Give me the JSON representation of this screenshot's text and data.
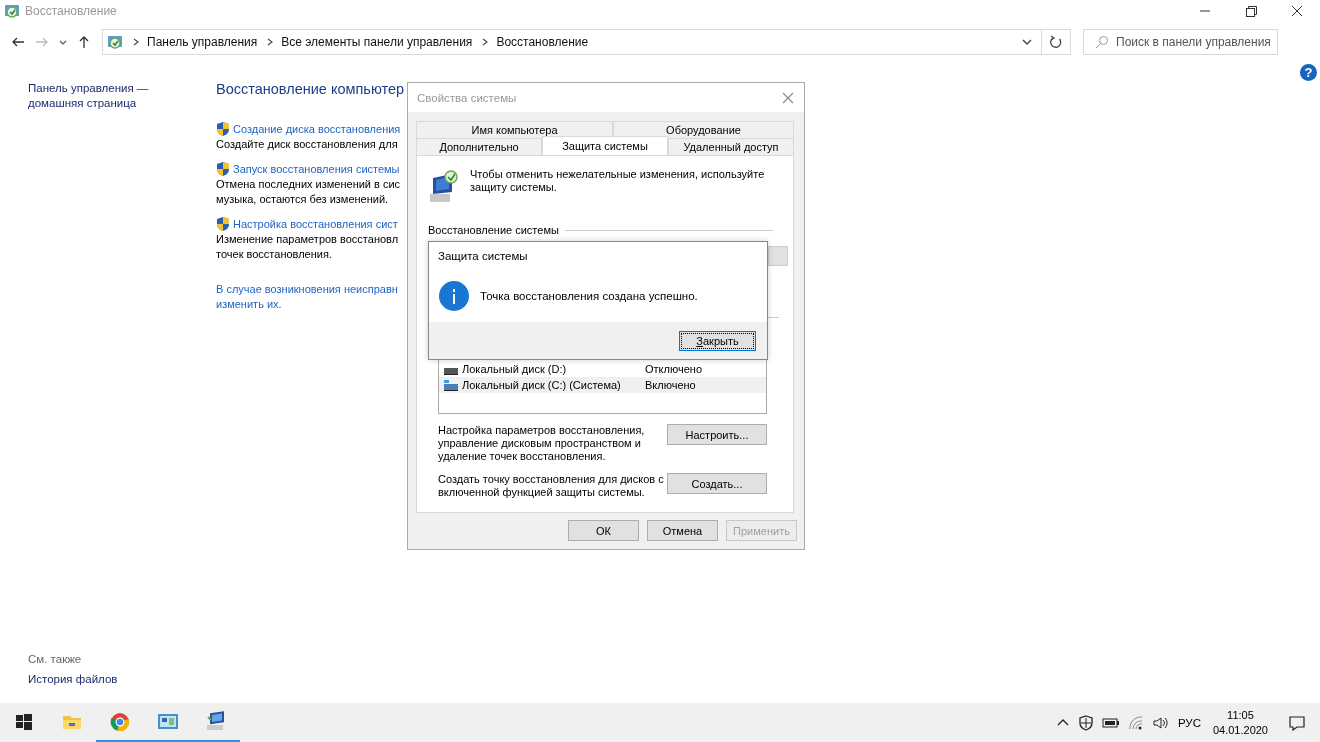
{
  "window": {
    "title": "Восстановление"
  },
  "address_bar": {
    "breadcrumbs": [
      "Панель управления",
      "Все элементы панели управления",
      "Восстановление"
    ],
    "search": {
      "placeholder": "Поиск в панели управления"
    }
  },
  "help": "?",
  "sidebar": {
    "home_link": "Панель управления — домашняя страница",
    "see_also": {
      "heading": "См. также",
      "links": [
        "История файлов"
      ]
    }
  },
  "main": {
    "title": "Восстановление компьютер",
    "tasks": [
      {
        "link": "Создание диска восстановления",
        "description_lines": [
          "Создайте диск восстановления для"
        ]
      },
      {
        "link": "Запуск восстановления системы",
        "description_lines": [
          "Отмена последних изменений в сис",
          "музыка, остаются без изменений."
        ]
      },
      {
        "link": "Настройка восстановления сист",
        "description_lines": [
          "Изменение параметров восстановл",
          "точек восстановления."
        ]
      }
    ],
    "footer_link_lines": [
      "В случае возникновения неисправн",
      "изменить их."
    ]
  },
  "system_properties": {
    "title": "Свойства системы",
    "tab_rows": [
      [
        {
          "label": "Имя компьютера",
          "selected": false
        },
        {
          "label": "Оборудование",
          "selected": false
        }
      ],
      [
        {
          "label": "Дополнительно",
          "selected": false
        },
        {
          "label": "Защита системы",
          "selected": true
        },
        {
          "label": "Удаленный доступ",
          "selected": false
        }
      ]
    ],
    "intro": "Чтобы отменить нежелательные изменения, используйте защиту системы.",
    "restore_group": "Восстановление системы",
    "drives": [
      {
        "name": "Локальный диск (D:)",
        "status": "Отключено",
        "system": false,
        "selected": false
      },
      {
        "name": "Локальный диск (C:) (Система)",
        "status": "Включено",
        "system": true,
        "selected": true
      }
    ],
    "configure_text": "Настройка параметров восстановления, управление дисковым пространством и удаление точек восстановления.",
    "configure_button": "Настроить...",
    "create_text": "Создать точку восстановления для дисков с включенной функцией защиты системы.",
    "create_button": "Создать...",
    "buttons": [
      {
        "label": "ОК",
        "disabled": false
      },
      {
        "label": "Отмена",
        "disabled": false
      },
      {
        "label": "Применить",
        "disabled": true
      }
    ]
  },
  "message_box": {
    "title": "Защита системы",
    "message": "Точка восстановления создана успешно.",
    "button": "Закрыть"
  },
  "taskbar": {
    "apps": [
      {
        "kind": "start",
        "running": false
      },
      {
        "kind": "explorer",
        "running": false
      },
      {
        "kind": "browser",
        "running": true
      },
      {
        "kind": "control-panel",
        "running": true
      },
      {
        "kind": "system",
        "running": true
      }
    ],
    "language": "РУС",
    "time": "11:05",
    "date": "04.01.2020"
  }
}
